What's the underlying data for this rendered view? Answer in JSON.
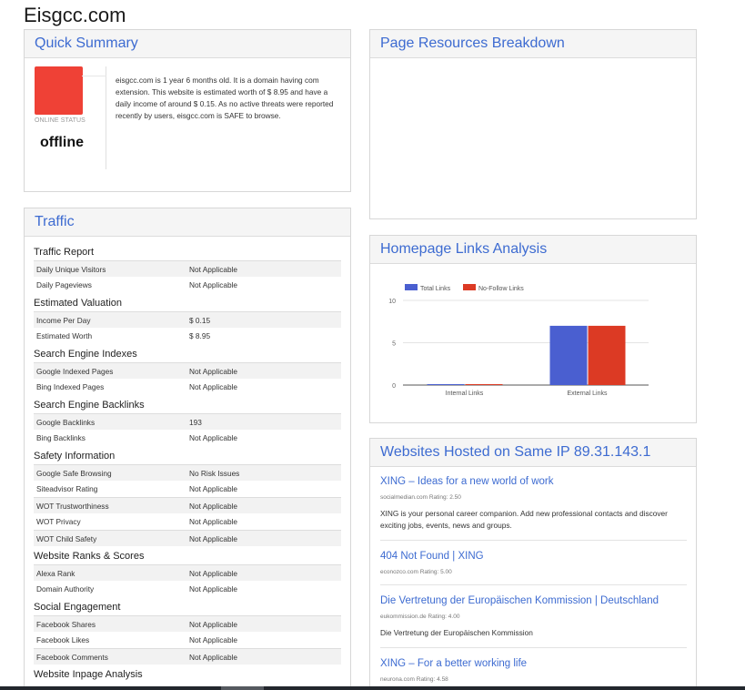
{
  "site": {
    "title": "Eisgcc.com"
  },
  "quick_summary": {
    "heading": "Quick Summary",
    "status_label": "ONLINE STATUS",
    "status_value": "offline",
    "status_color": "#ef4136",
    "text": "eisgcc.com is 1 year 6 months old. It is a domain having com extension. This website is estimated worth of $ 8.95 and have a daily income of around $ 0.15. As no active threats were reported recently by users, eisgcc.com is SAFE to browse."
  },
  "page_resources": {
    "heading": "Page Resources Breakdown"
  },
  "traffic": {
    "heading": "Traffic",
    "sections": [
      {
        "title": "Traffic Report",
        "rows": [
          {
            "label": "Daily Unique Visitors",
            "value": "Not Applicable"
          },
          {
            "label": "Daily Pageviews",
            "value": "Not Applicable"
          }
        ]
      },
      {
        "title": "Estimated Valuation",
        "rows": [
          {
            "label": "Income Per Day",
            "value": "$ 0.15"
          },
          {
            "label": "Estimated Worth",
            "value": "$ 8.95"
          }
        ]
      },
      {
        "title": "Search Engine Indexes",
        "rows": [
          {
            "label": "Google Indexed Pages",
            "value": "Not Applicable"
          },
          {
            "label": "Bing Indexed Pages",
            "value": "Not Applicable"
          }
        ]
      },
      {
        "title": "Search Engine Backlinks",
        "rows": [
          {
            "label": "Google Backlinks",
            "value": "193"
          },
          {
            "label": "Bing Backlinks",
            "value": "Not Applicable"
          }
        ]
      },
      {
        "title": "Safety Information",
        "rows": [
          {
            "label": "Google Safe Browsing",
            "value": "No Risk Issues"
          },
          {
            "label": "Siteadvisor Rating",
            "value": "Not Applicable"
          },
          {
            "label": "WOT Trustworthiness",
            "value": "Not Applicable"
          },
          {
            "label": "WOT Privacy",
            "value": "Not Applicable"
          },
          {
            "label": "WOT Child Safety",
            "value": "Not Applicable"
          }
        ]
      },
      {
        "title": "Website Ranks & Scores",
        "rows": [
          {
            "label": "Alexa Rank",
            "value": "Not Applicable"
          },
          {
            "label": "Domain Authority",
            "value": "Not Applicable"
          }
        ]
      },
      {
        "title": "Social Engagement",
        "rows": [
          {
            "label": "Facebook Shares",
            "value": "Not Applicable"
          },
          {
            "label": "Facebook Likes",
            "value": "Not Applicable"
          },
          {
            "label": "Facebook Comments",
            "value": "Not Applicable"
          }
        ]
      },
      {
        "title": "Website Inpage Analysis",
        "rows": []
      }
    ]
  },
  "links_analysis": {
    "heading": "Homepage Links Analysis",
    "chart_data": {
      "type": "bar",
      "categories": [
        "Internal Links",
        "External Links"
      ],
      "series": [
        {
          "name": "Total Links",
          "color": "#4a5fd0",
          "values": [
            0,
            7
          ]
        },
        {
          "name": "No-Follow Links",
          "color": "#dc3a24",
          "values": [
            0,
            7
          ]
        }
      ],
      "ylim": [
        0,
        10
      ],
      "yticks": [
        0,
        5,
        10
      ],
      "grid": true,
      "legend": "top-left"
    }
  },
  "same_ip": {
    "heading": "Websites Hosted on Same IP 89.31.143.1",
    "items": [
      {
        "title": "XING – Ideas for a new world of work",
        "meta": "socialmedian.com Rating: 2.50",
        "desc": "XING is your personal career companion. Add new professional contacts and discover exciting jobs, events, news and groups."
      },
      {
        "title": "404 Not Found | XING",
        "meta": "econozco.com Rating: 5.00",
        "desc": ""
      },
      {
        "title": "Die Vertretung der Europäischen Kommission | Deutschland",
        "meta": "eukommission.de Rating: 4.00",
        "desc": "Die Vertretung der Europäischen Kommission"
      },
      {
        "title": "XING – For a better working life",
        "meta": "neurona.com Rating: 4.58",
        "desc": ""
      }
    ]
  }
}
